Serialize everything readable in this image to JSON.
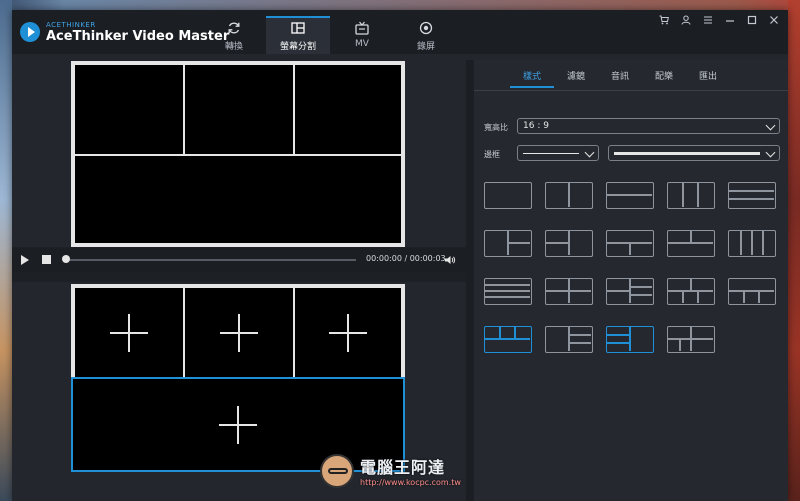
{
  "app": {
    "brand_small": "ACETHINKER",
    "title": "AceThinker Video Master"
  },
  "main_tabs": [
    {
      "label": "轉換",
      "icon": "refresh-icon"
    },
    {
      "label": "螢幕分割",
      "icon": "split-screen-icon",
      "active": true
    },
    {
      "label": "MV",
      "icon": "tv-icon"
    },
    {
      "label": "錄屏",
      "icon": "record-icon"
    }
  ],
  "window_controls": [
    "cart-icon",
    "user-icon",
    "menu-icon",
    "minimize-icon",
    "maximize-icon",
    "close-icon"
  ],
  "player": {
    "time": "00:00:00 / 00:00:03"
  },
  "sub_tabs": [
    {
      "label": "樣式",
      "active": true
    },
    {
      "label": "濾鏡"
    },
    {
      "label": "音訊"
    },
    {
      "label": "配樂"
    },
    {
      "label": "匯出"
    }
  ],
  "fields": {
    "aspect_label": "寬高比",
    "aspect_value": "16 : 9",
    "border_label": "邊框"
  },
  "watermark": {
    "text": "電腦王阿達",
    "url": "http://www.kocpc.com.tw"
  },
  "colors": {
    "accent": "#1f8fd6",
    "background": "#23272d",
    "panel": "#25292f"
  }
}
